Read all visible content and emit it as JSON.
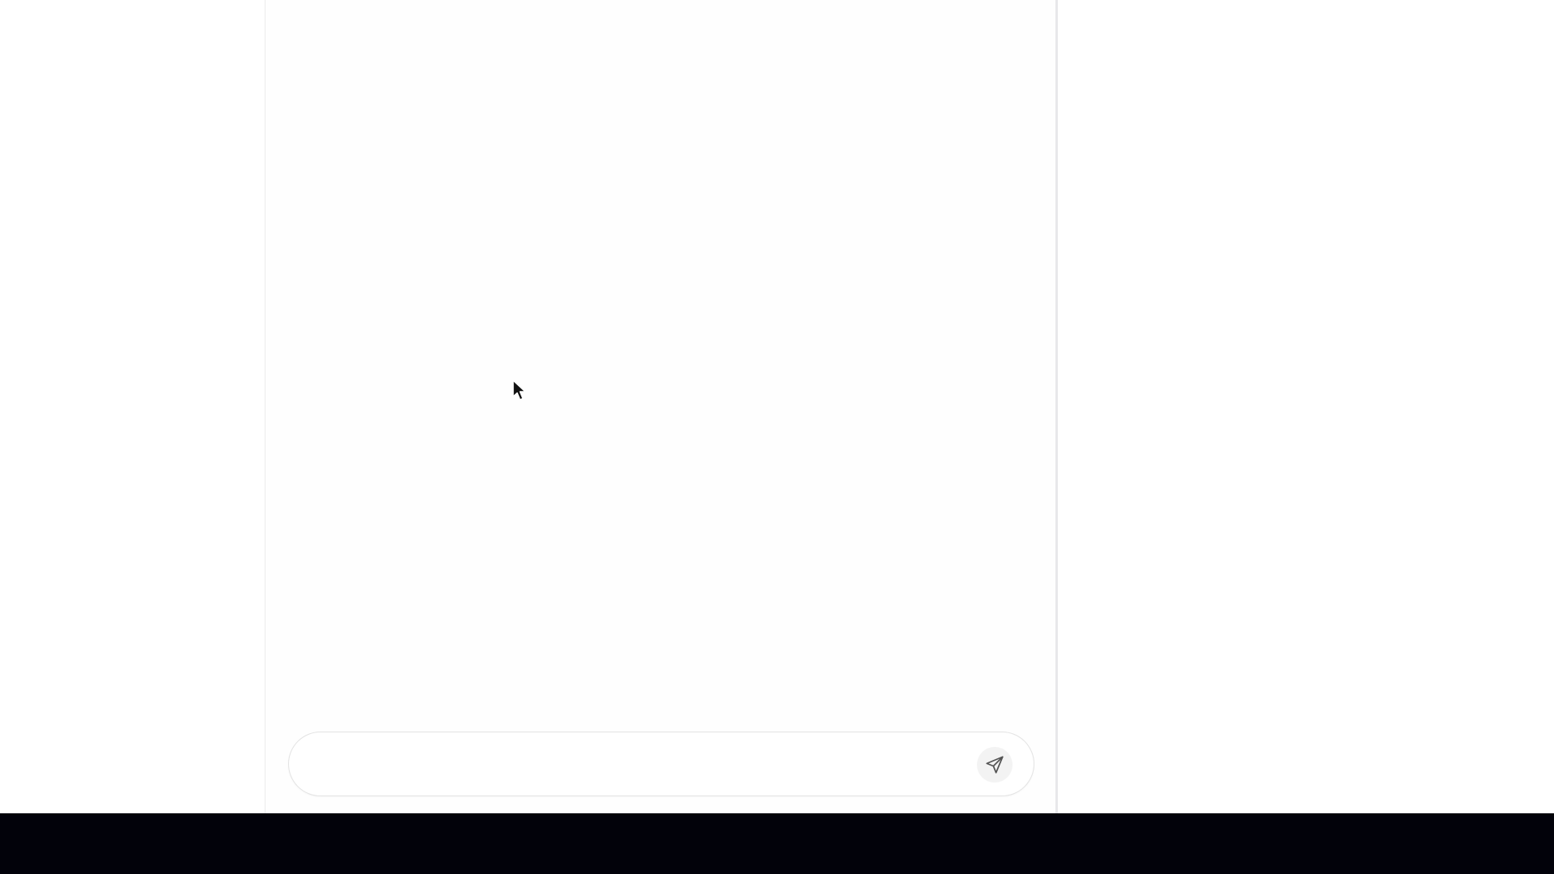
{
  "composer": {
    "value": "",
    "placeholder": ""
  },
  "icons": {
    "send": "send-icon",
    "cursor": "mouse-pointer-icon"
  },
  "colors": {
    "panel_background": "#fefefe",
    "panel_border": "#e8e8ea",
    "send_button_background": "#f3f3f3",
    "taskbar_background": "#02020a"
  }
}
